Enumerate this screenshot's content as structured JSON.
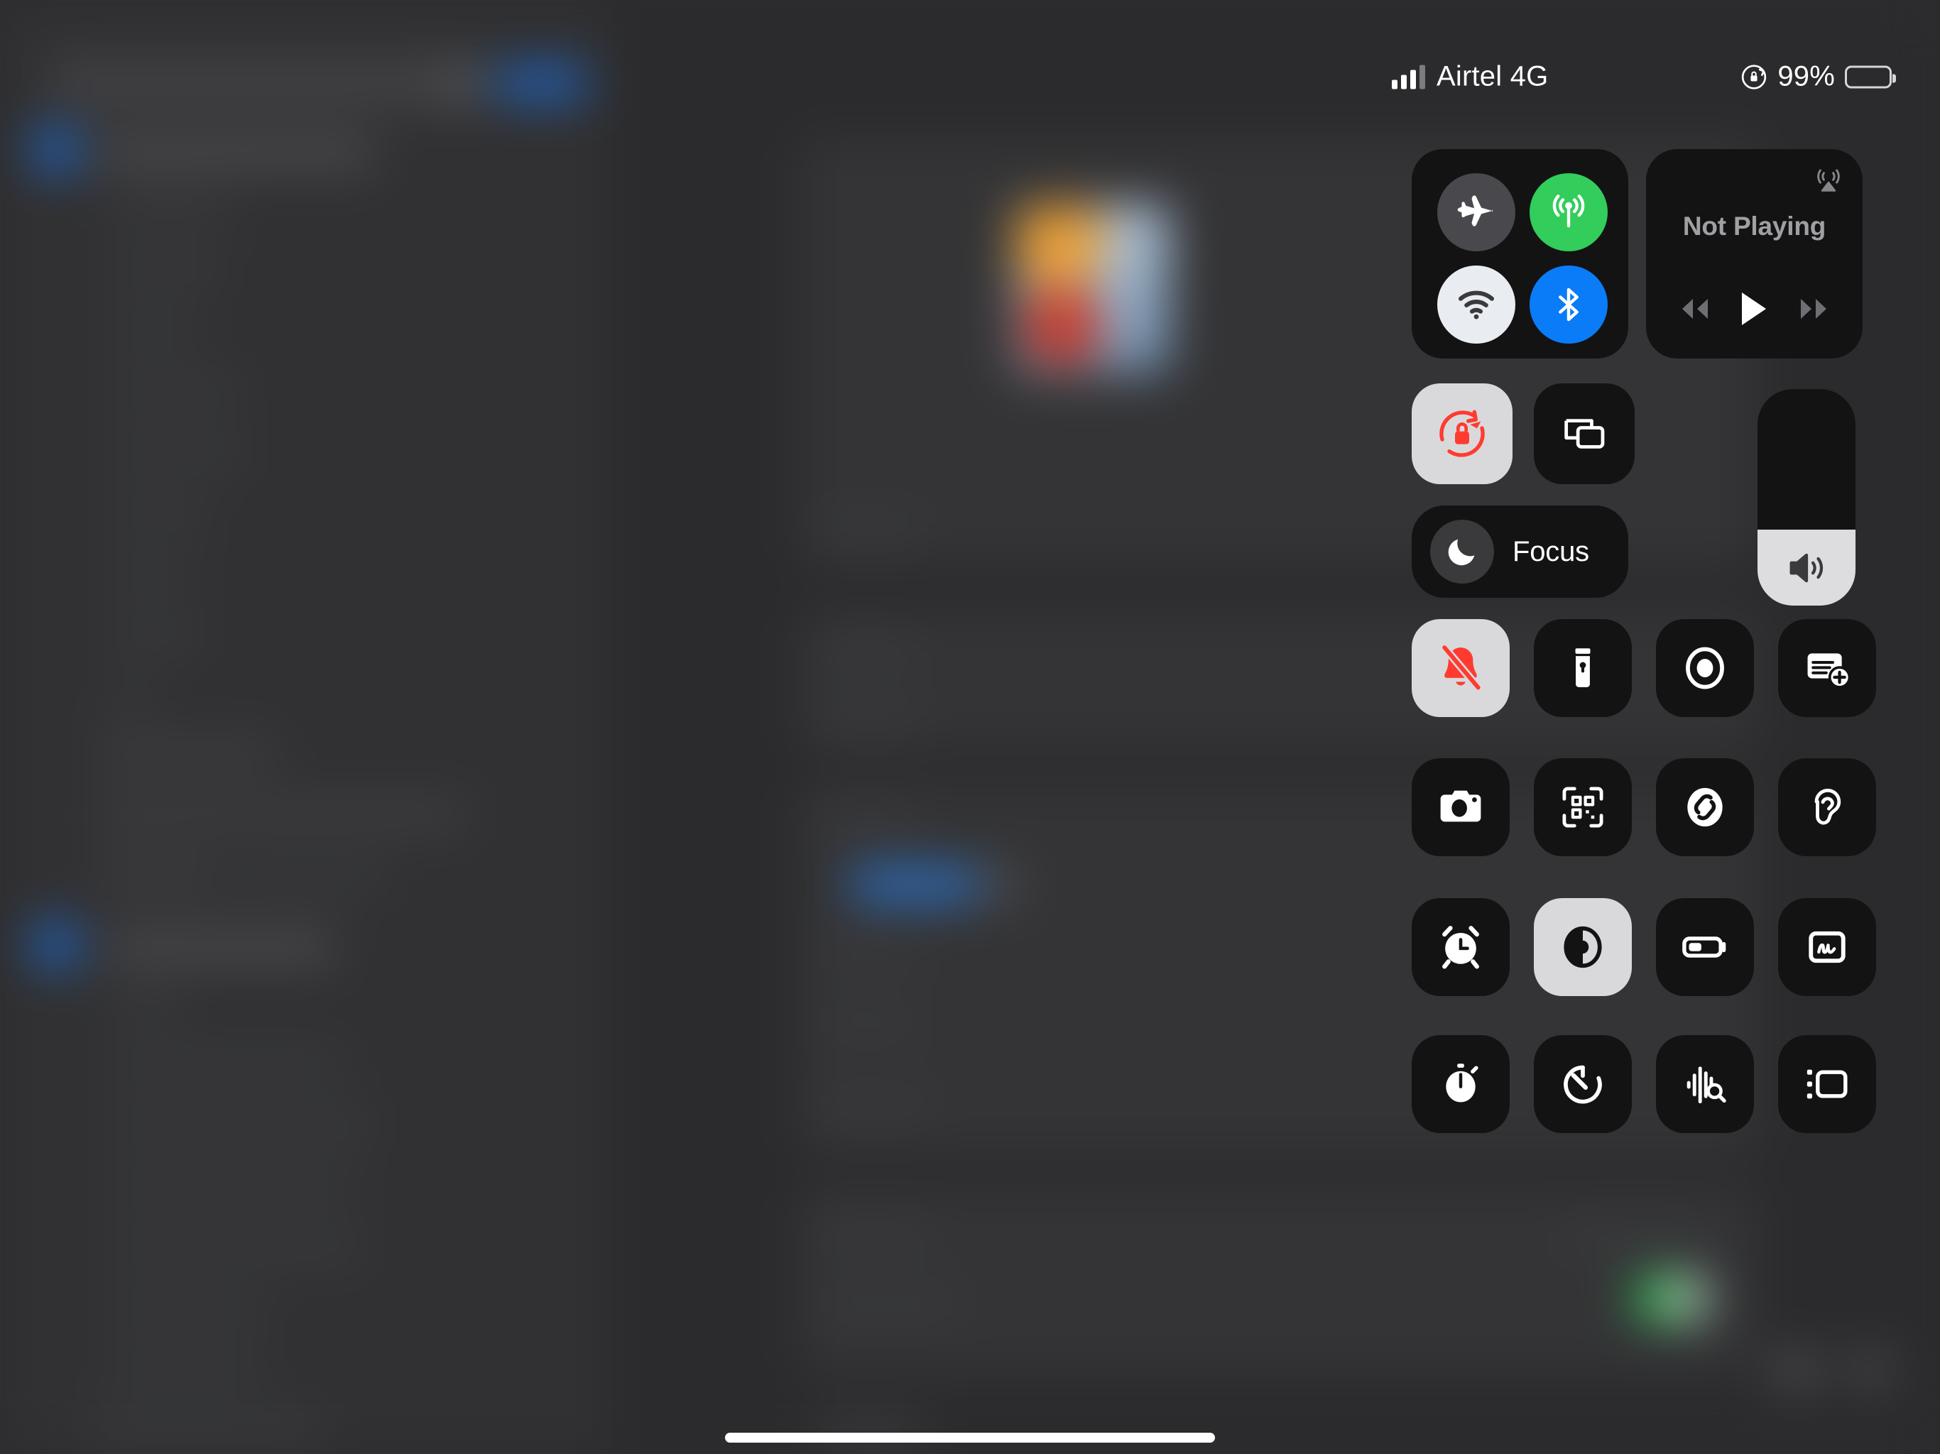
{
  "status_bar": {
    "carrier": "Airtel 4G",
    "battery_percent": "99%",
    "signal_bars_filled": 3,
    "signal_bars_total": 4,
    "rotation_lock_icon": "rotation-lock-icon",
    "battery_icon": "battery-icon"
  },
  "control_center": {
    "connectivity": {
      "airplane_mode": {
        "name": "Airplane Mode",
        "icon": "airplane-icon",
        "state": "off",
        "color": "#49494d"
      },
      "cellular_data": {
        "name": "Cellular Data",
        "icon": "cellular-icon",
        "state": "on",
        "color": "#32cd5b"
      },
      "wifi": {
        "name": "Wi-Fi",
        "icon": "wifi-icon",
        "state": "on",
        "color": "#e9ecf0"
      },
      "bluetooth": {
        "name": "Bluetooth",
        "icon": "bluetooth-icon",
        "state": "on",
        "color": "#0b7cf7"
      }
    },
    "media": {
      "title": "Not Playing",
      "airplay_icon": "airplay-icon",
      "rewind_icon": "rewind-icon",
      "play_icon": "play-icon",
      "forward_icon": "fast-forward-icon"
    },
    "rotation_lock": {
      "name": "Rotation Lock",
      "icon": "rotation-lock-icon",
      "state": "on",
      "accent": "#ff3b30"
    },
    "screen_mirroring": {
      "name": "Screen Mirroring",
      "icon": "screen-mirroring-icon",
      "state": "off"
    },
    "focus": {
      "label": "Focus",
      "icon": "moon-icon",
      "state": "off"
    },
    "volume": {
      "name": "Volume",
      "icon": "speaker-icon",
      "level_percent": 35
    },
    "tiles": [
      {
        "name": "Silent Mode",
        "icon": "bell-slash-icon",
        "state": "on",
        "accent": "#ff3b30"
      },
      {
        "name": "Flashlight",
        "icon": "flashlight-icon",
        "state": "off"
      },
      {
        "name": "Screen Recording",
        "icon": "record-icon",
        "state": "off"
      },
      {
        "name": "New Note",
        "icon": "new-note-icon",
        "state": "off"
      },
      {
        "name": "Camera",
        "icon": "camera-icon",
        "state": "off"
      },
      {
        "name": "Code Scanner",
        "icon": "qr-scanner-icon",
        "state": "off"
      },
      {
        "name": "Shazam",
        "icon": "shazam-icon",
        "state": "off"
      },
      {
        "name": "Hearing",
        "icon": "ear-icon",
        "state": "off"
      },
      {
        "name": "Alarm",
        "icon": "alarm-clock-icon",
        "state": "off"
      },
      {
        "name": "Dark Mode",
        "icon": "dark-mode-icon",
        "state": "on"
      },
      {
        "name": "Low Power Mode",
        "icon": "low-battery-icon",
        "state": "off"
      },
      {
        "name": "Quick Note",
        "icon": "quick-note-icon",
        "state": "off"
      },
      {
        "name": "Stopwatch",
        "icon": "stopwatch-icon",
        "state": "off"
      },
      {
        "name": "Timer",
        "icon": "timer-icon",
        "state": "off"
      },
      {
        "name": "Sound Recognition",
        "icon": "sound-recognition-icon",
        "state": "off"
      },
      {
        "name": "Stage Manager",
        "icon": "stage-manager-icon",
        "state": "off"
      }
    ]
  },
  "home_indicator": {
    "name": "home-indicator"
  }
}
